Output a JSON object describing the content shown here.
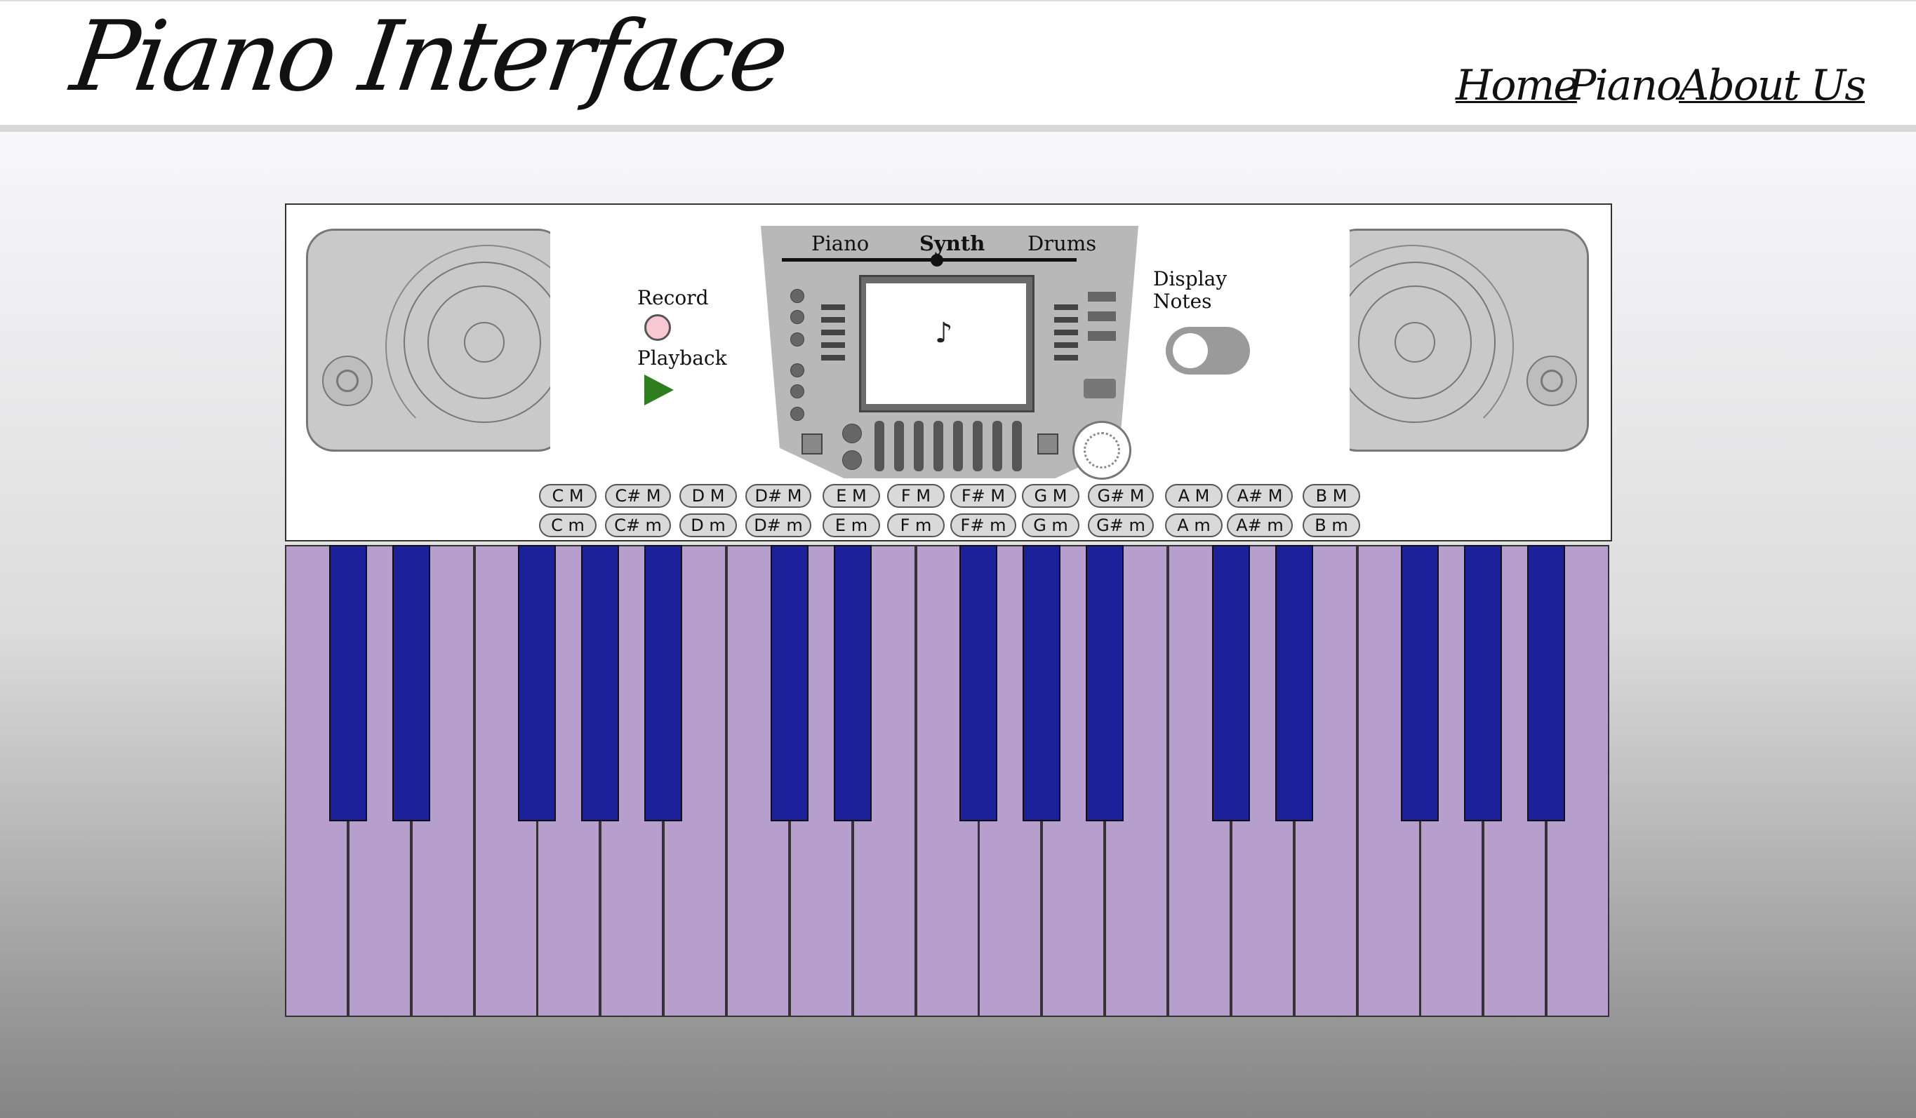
{
  "site": {
    "title": "Piano Interface"
  },
  "nav": {
    "home": "Home",
    "piano": "Piano",
    "about": "About Us"
  },
  "controls": {
    "record_label": "Record",
    "playback_label": "Playback",
    "display_notes_label_line1": "Display",
    "display_notes_label_line2": "Notes",
    "display_notes_on": false
  },
  "modes": {
    "items": [
      "Piano",
      "Synth",
      "Drums"
    ],
    "selected": "Synth"
  },
  "screen": {
    "note": "♪"
  },
  "chords": {
    "major": [
      "C M",
      "C# M",
      "D M",
      "D# M",
      "E M",
      "F M",
      "F# M",
      "G M",
      "G# M",
      "A M",
      "A# M",
      "B M"
    ],
    "minor": [
      "C m",
      "C# m",
      "D m",
      "D# m",
      "E m",
      "F m",
      "F# m",
      "G m",
      "G# m",
      "A m",
      "A# m",
      "B m"
    ]
  },
  "colors": {
    "white_key": "#b79fcd",
    "black_key": "#1c209a",
    "record": "#f7c7d2",
    "playback": "#2e7d1e"
  },
  "keyboard": {
    "white_keys": 21,
    "black_keys": 15,
    "octaves": 3
  }
}
